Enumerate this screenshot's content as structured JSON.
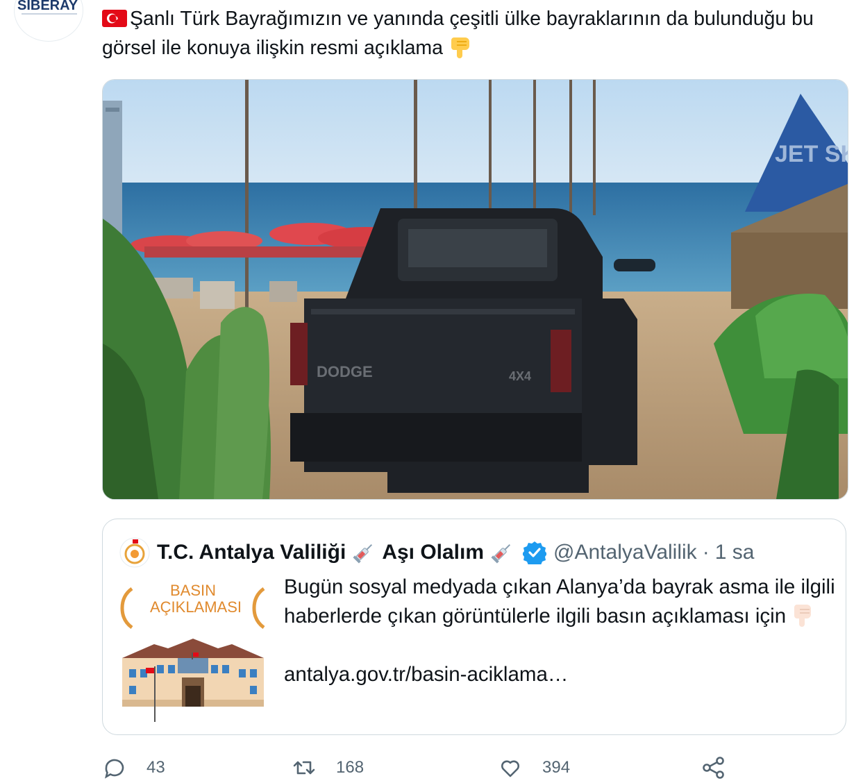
{
  "profile": {
    "avatar_text": "SİBERAY"
  },
  "tweet": {
    "text": "Şanlı Türk Bayrağımızın ve yanında çeşitli ülke bayraklarının da bulunduğu bu görsel ile konuya ilişkin resmi açıklama",
    "emoji_prefix": "turkey-flag",
    "emoji_suffix": "backhand-index-pointing-down"
  },
  "media": {
    "description_icons": [
      "photo"
    ],
    "tent_sign_text": "JET SKI",
    "truck_tailgate_text": "DODGE",
    "truck_badge_text": "4X4"
  },
  "quoted_tweet": {
    "name": "T.C. Antalya Valiliği",
    "name_extra": "Aşı Olalım",
    "handle": "@AntalyaValilik",
    "separator": "·",
    "time": "1 sa",
    "thumbnail_title_line1": "BASIN",
    "thumbnail_title_line2": "AÇIKLAMASI",
    "text": "Bugün sosyal medyada çıkan Alanya’da bayrak asma ile ilgili haberlerde çıkan görüntülerle ilgili basın açıklaması için",
    "link": "antalya.gov.tr/basin-aciklama…"
  },
  "actions": {
    "reply_count": "43",
    "retweet_count": "168",
    "like_count": "394"
  },
  "colors": {
    "text": "#0f1419",
    "secondary": "#536471",
    "border": "#cfd9de",
    "verified": "#1d9bf0"
  }
}
